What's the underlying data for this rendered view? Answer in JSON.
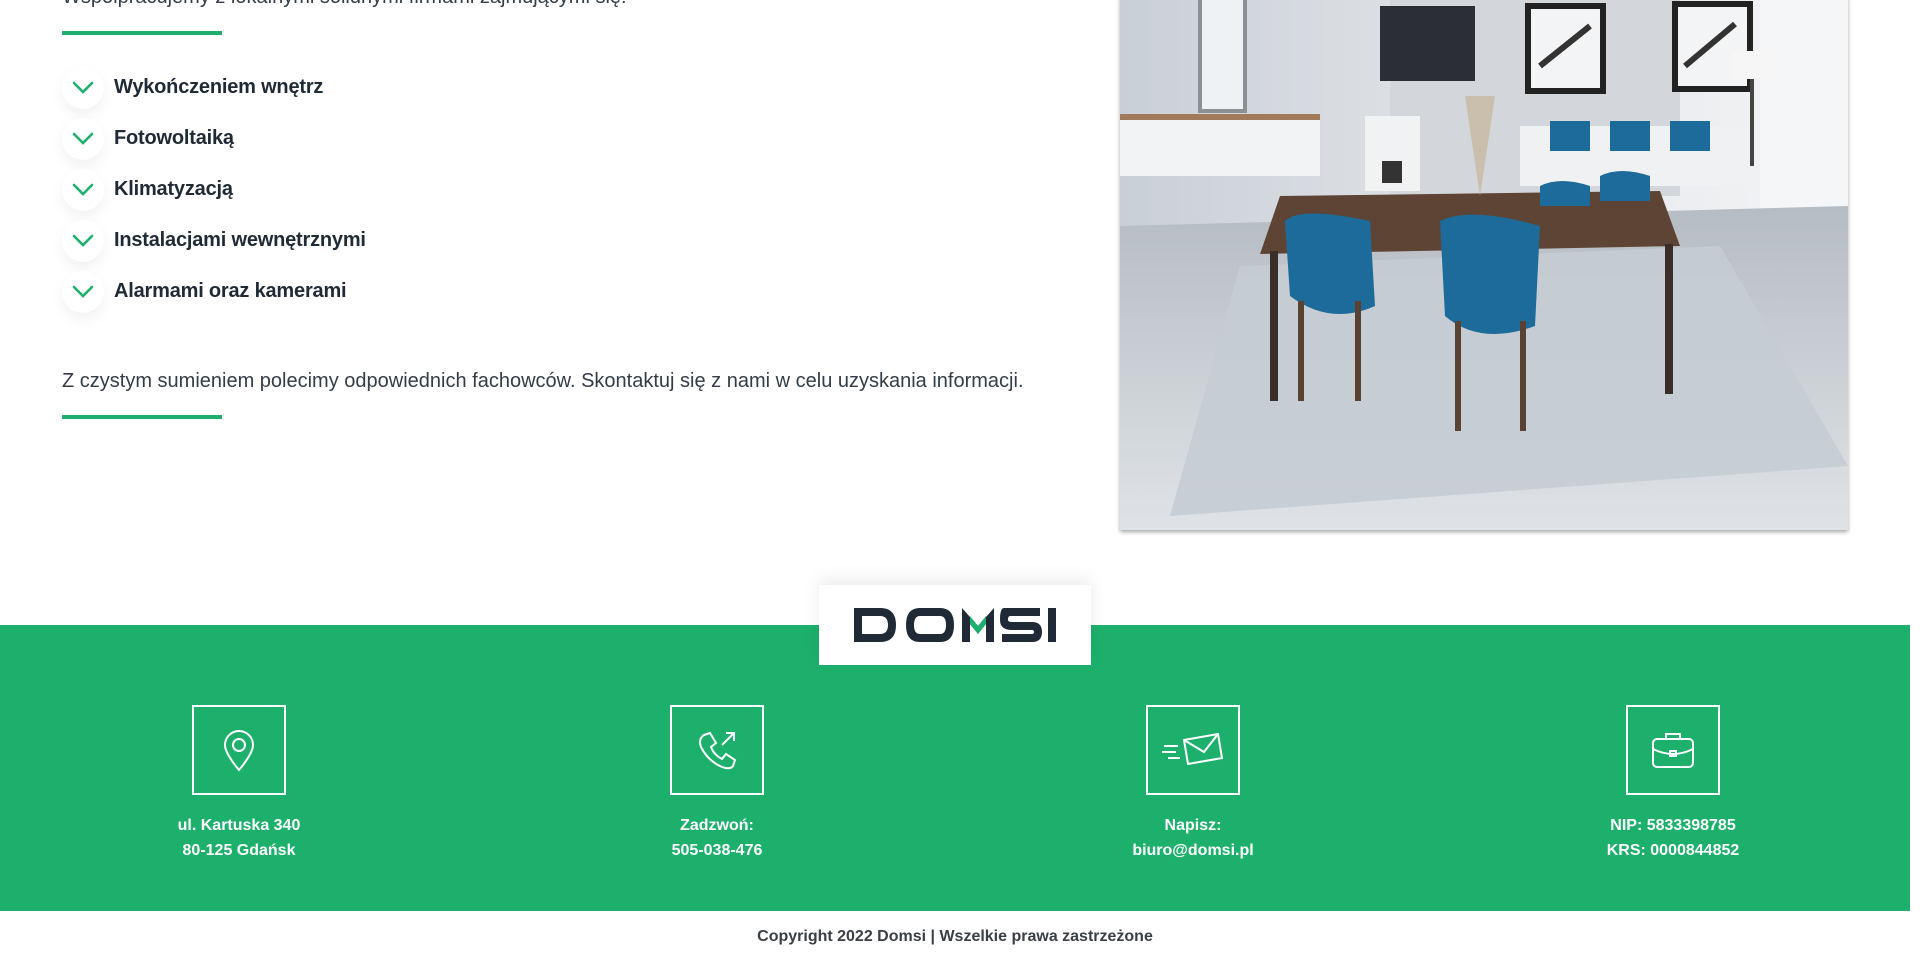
{
  "intro_text": "Współpracujemy z lokalnymi solidnymi firmami zajmującymi się:",
  "services": [
    {
      "label": "Wykończeniem wnętrz"
    },
    {
      "label": "Fotowoltaiką"
    },
    {
      "label": "Klimatyzacją"
    },
    {
      "label": "Instalacjami wewnętrznymi"
    },
    {
      "label": "Alarmami oraz kamerami"
    }
  ],
  "closing_text": "Z czystym sumieniem polecimy odpowiednich fachowców. Skontaktuj się z nami w celu uzyskania informacji.",
  "logo": {
    "text": "DOMSI"
  },
  "footer": {
    "address": {
      "line1": "ul. Kartuska 340",
      "line2": "80-125 Gdańsk"
    },
    "phone": {
      "line1": "Zadzwoń:",
      "line2": "505-038-476"
    },
    "email": {
      "line1": "Napisz:",
      "line2": "biuro@domsi.pl"
    },
    "company": {
      "line1": "NIP: 5833398785",
      "line2": "KRS: 0000844852"
    },
    "copyright": "Copyright 2022 Domsi | Wszelkie prawa zastrzeżone"
  },
  "colors": {
    "accent": "#1db06c",
    "text": "#1f2a36",
    "chair": "#1d6b9a"
  }
}
